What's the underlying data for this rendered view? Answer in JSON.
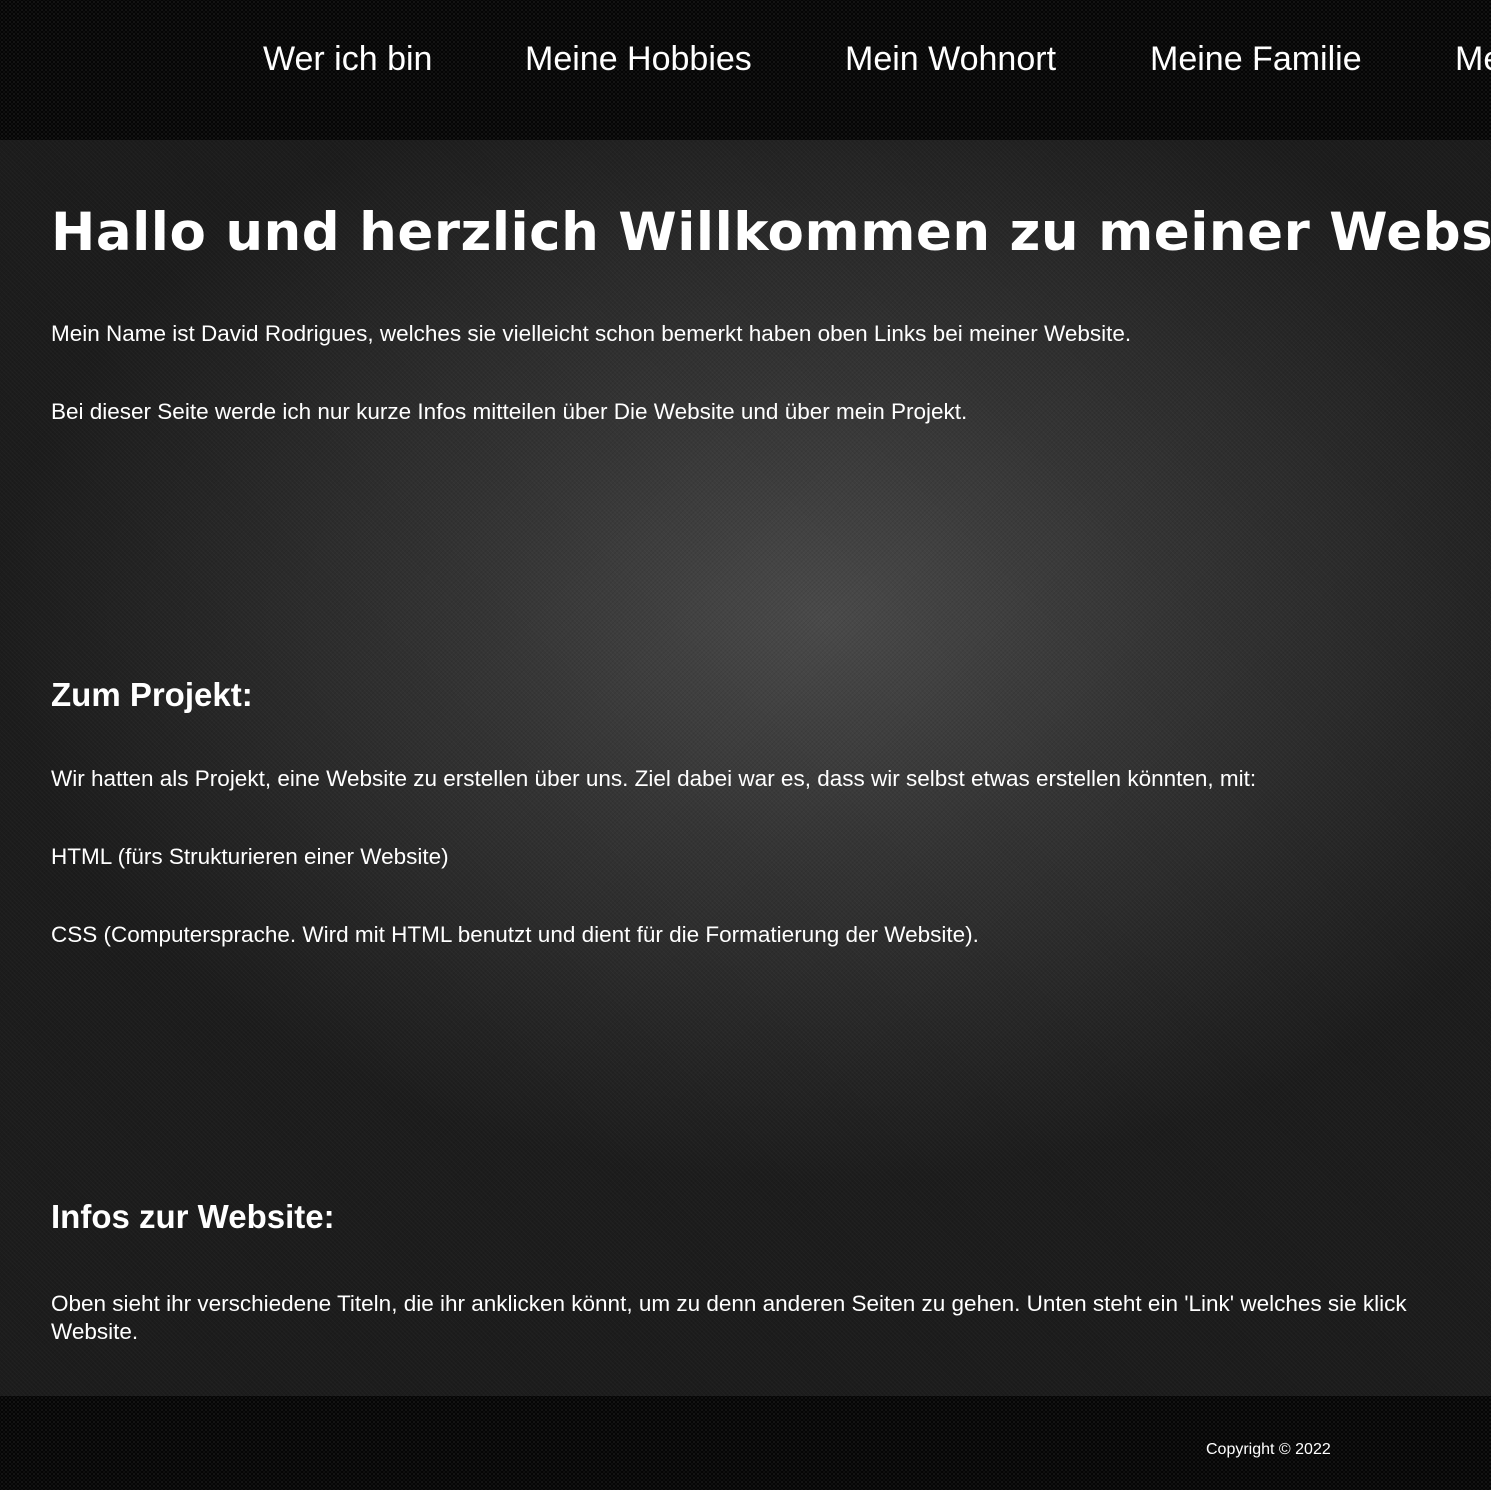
{
  "nav": {
    "items": [
      {
        "label": "Wer ich bin"
      },
      {
        "label": "Meine Hobbies"
      },
      {
        "label": "Mein Wohnort"
      },
      {
        "label": "Meine Familie"
      },
      {
        "label": "Me"
      }
    ]
  },
  "main": {
    "title": "Hallo und herzlich Willkommen zu meiner Webs",
    "intro": [
      "Mein Name ist David Rodrigues, welches sie vielleicht schon bemerkt haben oben Links bei meiner Website.",
      "Bei dieser Seite werde ich nur kurze Infos mitteilen über Die Website und über mein Projekt."
    ],
    "projekt": {
      "heading": "Zum Projekt:",
      "paragraphs": [
        "Wir hatten als Projekt, eine Website zu erstellen über uns. Ziel dabei war es, dass wir selbst etwas erstellen könnten, mit:",
        "HTML (fürs Strukturieren einer Website)",
        "CSS (Computersprache. Wird mit HTML benutzt und dient für die Formatierung der Website)."
      ]
    },
    "infos": {
      "heading": "Infos zur Website:",
      "paragraph_line1": "Oben sieht ihr verschiedene Titeln, die ihr anklicken könnt, um zu denn anderen Seiten zu gehen. Unten steht ein 'Link' welches sie klick",
      "paragraph_line2": "Website."
    }
  },
  "footer": {
    "copyright": "Copyright © 2022"
  }
}
